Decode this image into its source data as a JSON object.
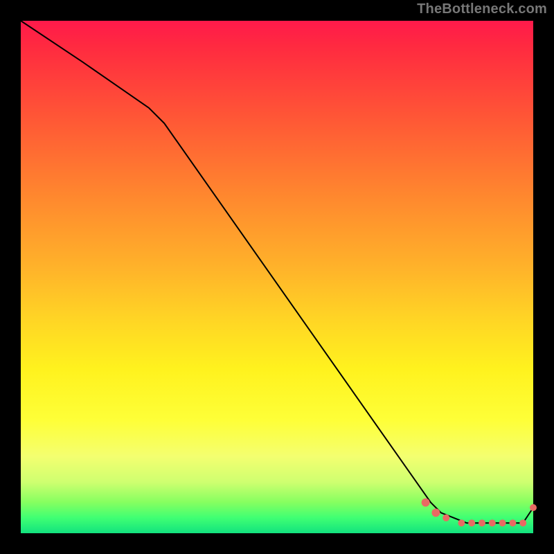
{
  "attribution": "TheBottleneck.com",
  "chart_data": {
    "type": "line",
    "title": "",
    "xlabel": "",
    "ylabel": "",
    "xlim": [
      0,
      100
    ],
    "ylim": [
      0,
      100
    ],
    "series": [
      {
        "name": "curve",
        "x": [
          0,
          12,
          25,
          28,
          80,
          82,
          87,
          98,
          100
        ],
        "values": [
          100,
          92,
          83,
          80,
          6,
          4,
          2,
          2,
          5
        ]
      }
    ],
    "markers": {
      "name": "points",
      "x": [
        79,
        81,
        83,
        86,
        88,
        90,
        92,
        94,
        96,
        98,
        100
      ],
      "values": [
        6,
        4,
        3,
        2,
        2,
        2,
        2,
        2,
        2,
        2,
        5
      ]
    },
    "colors": {
      "curve": "#000000",
      "markers": "#e96a63",
      "gradient_top": "#ff1a4b",
      "gradient_mid": "#fff21e",
      "gradient_bottom": "#12e27e"
    }
  }
}
